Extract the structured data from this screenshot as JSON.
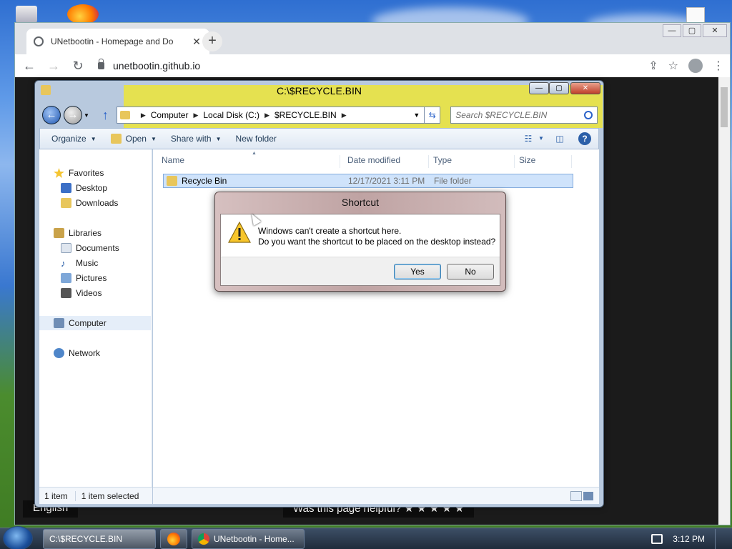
{
  "desktop": {
    "icons": [
      "recycle-bin-icon",
      "firefox-icon",
      "file-icon"
    ]
  },
  "chrome": {
    "tab_title": "UNetbootin - Homepage and Do",
    "url": "unetbootin.github.io",
    "page_overlay_bottom_left": "English",
    "page_overlay_bottom_center": "Was this page helpful? ★ ★ ★ ★ ★"
  },
  "explorer": {
    "title": "C:\\$RECYCLE.BIN",
    "breadcrumb": [
      "Computer",
      "Local Disk (C:)",
      "$RECYCLE.BIN"
    ],
    "search_placeholder": "Search $RECYCLE.BIN",
    "commands": [
      "Organize",
      "Open",
      "Share with",
      "New folder"
    ],
    "nav": {
      "favorites": "Favorites",
      "desktop": "Desktop",
      "downloads": "Downloads",
      "libraries": "Libraries",
      "documents": "Documents",
      "music": "Music",
      "pictures": "Pictures",
      "videos": "Videos",
      "computer": "Computer",
      "network": "Network"
    },
    "columns": [
      "Name",
      "Date modified",
      "Type",
      "Size"
    ],
    "rows": [
      {
        "name": "Recycle Bin",
        "date": "12/17/2021 3:11 PM",
        "type": "File folder",
        "size": ""
      }
    ],
    "status_count": "1 item",
    "status_selected": "1 item selected"
  },
  "dialog": {
    "title": "Shortcut",
    "line1": "Windows can't create a shortcut here.",
    "line2": "Do you want the shortcut to be placed on the desktop instead?",
    "yes": "Yes",
    "no": "No"
  },
  "taskbar": {
    "items": [
      "C:\\$RECYCLE.BIN",
      "UNetbootin - Home..."
    ],
    "clock": "3:12 PM"
  },
  "colors": {
    "selection": "#cfe3fb",
    "address_yellow": "#f2e828",
    "taskbar": "#1f2b3b"
  }
}
